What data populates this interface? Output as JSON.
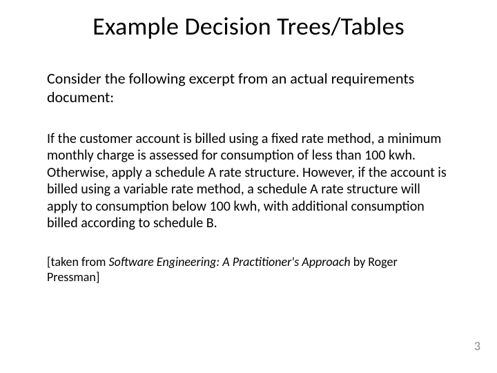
{
  "slide": {
    "title": "Example Decision Trees/Tables",
    "intro": "Consider the following excerpt from an actual requirements document:",
    "body": "If the customer account is billed using a fixed rate method, a minimum monthly charge is assessed for consumption of less than 100 kwh. Otherwise, apply a schedule A rate structure.  However, if the account is billed using a variable rate method, a schedule A rate structure will apply to consumption below 100 kwh, with additional consumption billed according to schedule B.",
    "citation_prefix": "[taken from ",
    "citation_book": "Software Engineering: A Practitioner's Approach",
    "citation_suffix": " by Roger Pressman]",
    "page_number": "3"
  }
}
